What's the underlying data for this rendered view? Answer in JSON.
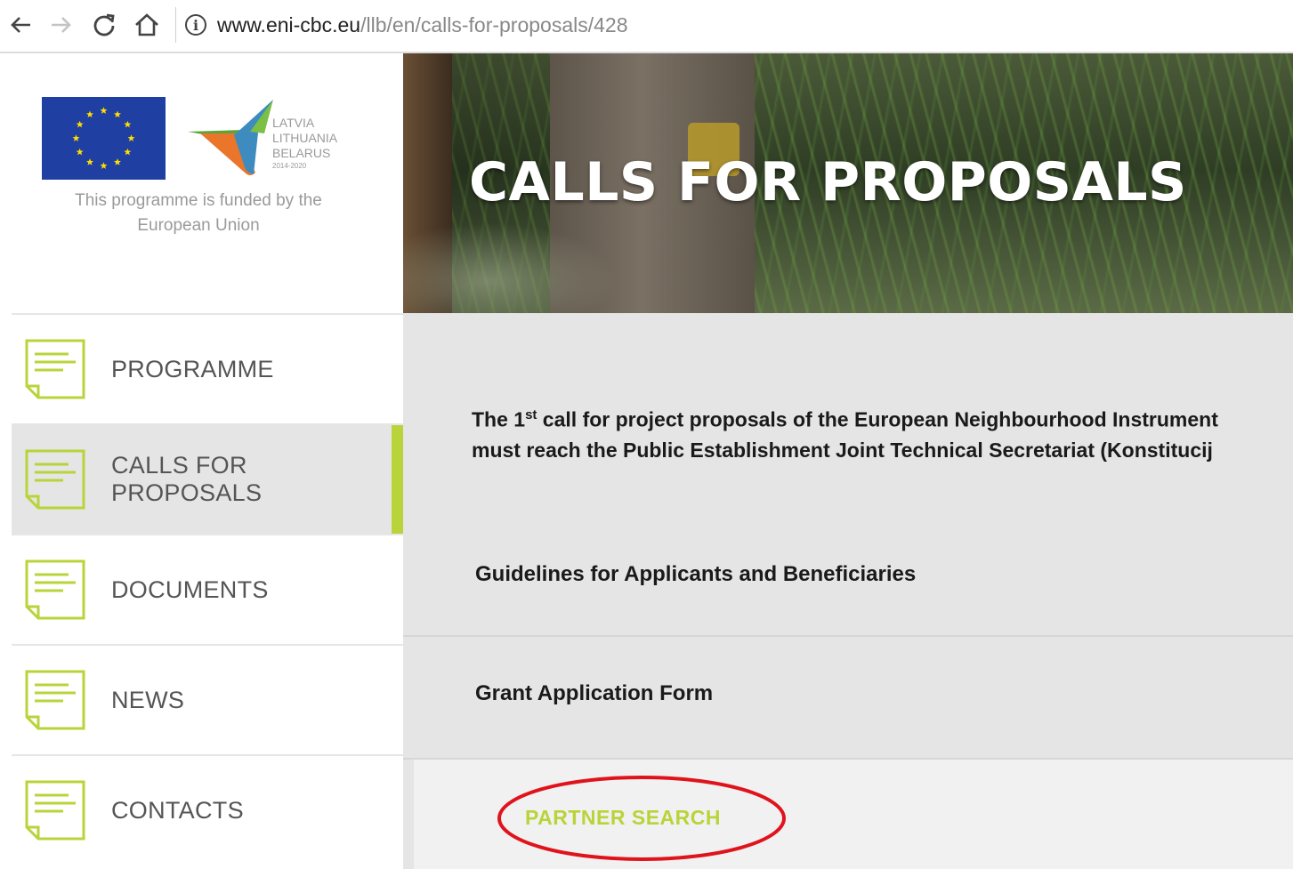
{
  "browser": {
    "url_domain": "www.eni-cbc.eu",
    "url_path": "/llb/en/calls-for-proposals/428",
    "info_glyph": "i"
  },
  "logo": {
    "llb_lines": [
      "LATVIA",
      "LITHUANIA",
      "BELARUS",
      "2014-2020"
    ],
    "funded_text": "This programme is funded by the European Union"
  },
  "sidebar": {
    "items": [
      {
        "label": "PROGRAMME",
        "active": false
      },
      {
        "label": "CALLS FOR PROPOSALS",
        "active": true
      },
      {
        "label": "DOCUMENTS",
        "active": false
      },
      {
        "label": "NEWS",
        "active": false
      },
      {
        "label": "CONTACTS",
        "active": false
      }
    ]
  },
  "hero": {
    "title": "CALLS FOR PROPOSALS"
  },
  "content": {
    "intro_prefix": "The 1",
    "intro_sup": "st",
    "intro_line1_rest": " call for project proposals of the European Neighbourhood Instrument",
    "intro_line2": "must reach the Public Establishment Joint Technical Secretariat (Konstitucij",
    "row1_label": "Guidelines for Applicants and Beneficiaries",
    "row2_label": "Grant Application Form",
    "partner_search": "PARTNER SEARCH"
  },
  "colors": {
    "accent": "#b8d43a",
    "eu_blue": "#1f3fa3",
    "eu_star": "#ffdd00",
    "highlight_red": "#e0131c"
  }
}
